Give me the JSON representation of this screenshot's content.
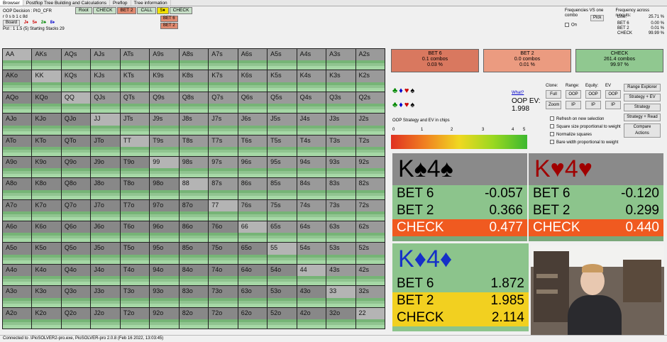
{
  "tabs": [
    "Browser",
    "Postflop Tree Building and Calculations",
    "Preflop",
    "Tree information"
  ],
  "info": {
    "decision": "OOP Decision : PIO_CFR",
    "board_cards": "r 0 s b 1 c 8d",
    "board_button": "Board",
    "pot": "Pot : 1 1.5 (5) Starting Stacks 29",
    "suits": [
      "J♦",
      "5♦",
      "2♣",
      "8♦"
    ]
  },
  "toolbar": {
    "buttons": [
      "Root",
      "CHECK",
      "BET 2",
      "CALL",
      "5♦",
      "CHECK"
    ],
    "sub_buttons": [
      "BET 6",
      "BET 2"
    ],
    "colors": [
      "#c8e0c8",
      "#c8e0c8",
      "#e08a70",
      "#c8e0c8",
      "#f0e000",
      "#c8e0c8"
    ]
  },
  "freq": {
    "title1": "Frequencies VS one combo",
    "pick": "Pick",
    "on": "On",
    "title2": "Frequency across runouts:",
    "line_label": "Line:",
    "line_value": "25.71 %",
    "rows": [
      {
        "label": "BET 6",
        "value": "0.00 %"
      },
      {
        "label": "BET 2",
        "value": "0.01 %"
      },
      {
        "label": "CHECK",
        "value": "99.99 %"
      }
    ]
  },
  "grid": {
    "hands": [
      [
        "AA",
        "AKs",
        "AQs",
        "AJs",
        "ATs",
        "A9s",
        "A8s",
        "A7s",
        "A6s",
        "A5s",
        "A4s",
        "A3s",
        "A2s"
      ],
      [
        "AKo",
        "KK",
        "KQs",
        "KJs",
        "KTs",
        "K9s",
        "K8s",
        "K7s",
        "K6s",
        "K5s",
        "K4s",
        "K3s",
        "K2s"
      ],
      [
        "AQo",
        "KQo",
        "QQ",
        "QJs",
        "QTs",
        "Q9s",
        "Q8s",
        "Q7s",
        "Q6s",
        "Q5s",
        "Q4s",
        "Q3s",
        "Q2s"
      ],
      [
        "AJo",
        "KJo",
        "QJo",
        "JJ",
        "JTs",
        "J9s",
        "J8s",
        "J7s",
        "J6s",
        "J5s",
        "J4s",
        "J3s",
        "J2s"
      ],
      [
        "ATo",
        "KTo",
        "QTo",
        "JTo",
        "TT",
        "T9s",
        "T8s",
        "T7s",
        "T6s",
        "T5s",
        "T4s",
        "T3s",
        "T2s"
      ],
      [
        "A9o",
        "K9o",
        "Q9o",
        "J9o",
        "T9o",
        "99",
        "98s",
        "97s",
        "96s",
        "95s",
        "94s",
        "93s",
        "92s"
      ],
      [
        "A8o",
        "K8o",
        "Q8o",
        "J8o",
        "T8o",
        "98o",
        "88",
        "87s",
        "86s",
        "85s",
        "84s",
        "83s",
        "82s"
      ],
      [
        "A7o",
        "K7o",
        "Q7o",
        "J7o",
        "T7o",
        "97o",
        "87o",
        "77",
        "76s",
        "75s",
        "74s",
        "73s",
        "72s"
      ],
      [
        "A6o",
        "K6o",
        "Q6o",
        "J6o",
        "T6o",
        "96o",
        "86o",
        "76o",
        "66",
        "65s",
        "64s",
        "63s",
        "62s"
      ],
      [
        "A5o",
        "K5o",
        "Q5o",
        "J5o",
        "T5o",
        "95o",
        "85o",
        "75o",
        "65o",
        "55",
        "54s",
        "53s",
        "52s"
      ],
      [
        "A4o",
        "K4o",
        "Q4o",
        "J4o",
        "T4o",
        "94o",
        "84o",
        "74o",
        "64o",
        "54o",
        "44",
        "43s",
        "42s"
      ],
      [
        "A3o",
        "K3o",
        "Q3o",
        "J3o",
        "T3o",
        "93o",
        "83o",
        "73o",
        "63o",
        "53o",
        "43o",
        "33",
        "32s"
      ],
      [
        "A2o",
        "K2o",
        "Q2o",
        "J2o",
        "T2o",
        "92o",
        "82o",
        "72o",
        "62o",
        "52o",
        "42o",
        "32o",
        "22"
      ]
    ],
    "row_label": "BET 6 / BET 2 / CHECK"
  },
  "actions": [
    {
      "label": "BET 6",
      "combos": "0.1 combos",
      "pct": "0.03 %",
      "color": "#d9785f"
    },
    {
      "label": "BET 2",
      "combos": "0.0 combos",
      "pct": "0.01 %",
      "color": "#eb9b80"
    },
    {
      "label": "CHECK",
      "combos": "261.4 combos",
      "pct": "99.97 %",
      "color": "#90c890"
    }
  ],
  "mid": {
    "suits_top": [
      "♣",
      "♦",
      "♥",
      "♠"
    ],
    "suits_bot": [
      "♣",
      "♦",
      "♥",
      "♠"
    ],
    "what": "What?",
    "ev_label": "OOP EV:",
    "ev_value": "1.998",
    "clone": "Clone:",
    "range": "Range:",
    "equity": "Equity:",
    "ev": "EV",
    "col_buttons": [
      [
        "Full",
        "Zoom"
      ],
      [
        "OOP",
        "IP"
      ],
      [
        "OOP",
        "IP"
      ],
      [
        "OOP",
        "IP"
      ]
    ],
    "right_buttons": [
      "Range Explorer",
      "Strategy + EV",
      "Strategy",
      "Strategy + Read",
      "Compare Actions"
    ],
    "checks": [
      "Refresh on new selection",
      "Square size proportional to weight",
      "Normalize squares",
      "Bare width proportional to weight"
    ],
    "scale_title": "OOP Strategy and EV in chips",
    "scale_ticks": [
      "0",
      "1",
      "2",
      "3",
      "4",
      "5"
    ]
  },
  "cards": [
    {
      "name": "K♠4♠",
      "color": "#000",
      "rows": [
        {
          "label": "BET 6",
          "value": "-0.057"
        },
        {
          "label": "BET 2",
          "value": "0.366"
        },
        {
          "label": "CHECK",
          "value": "0.477"
        }
      ]
    },
    {
      "name": "K♥4♥",
      "color": "#a00000",
      "rows": [
        {
          "label": "BET 6",
          "value": "-0.120"
        },
        {
          "label": "BET 2",
          "value": "0.299"
        },
        {
          "label": "CHECK",
          "value": "0.440"
        }
      ]
    },
    {
      "name": "K♦4♦",
      "color": "#1530c8",
      "rows": [
        {
          "label": "BET 6",
          "value": "1.872"
        },
        {
          "label": "BET 2",
          "value": "1.985"
        },
        {
          "label": "CHECK",
          "value": "2.114"
        }
      ]
    }
  ],
  "status": "Connected to .\\PioSOLVER2-pro.exe, PioSOLVER-pro 2.0.8 (Feb 16 2022, 13:03:45)"
}
